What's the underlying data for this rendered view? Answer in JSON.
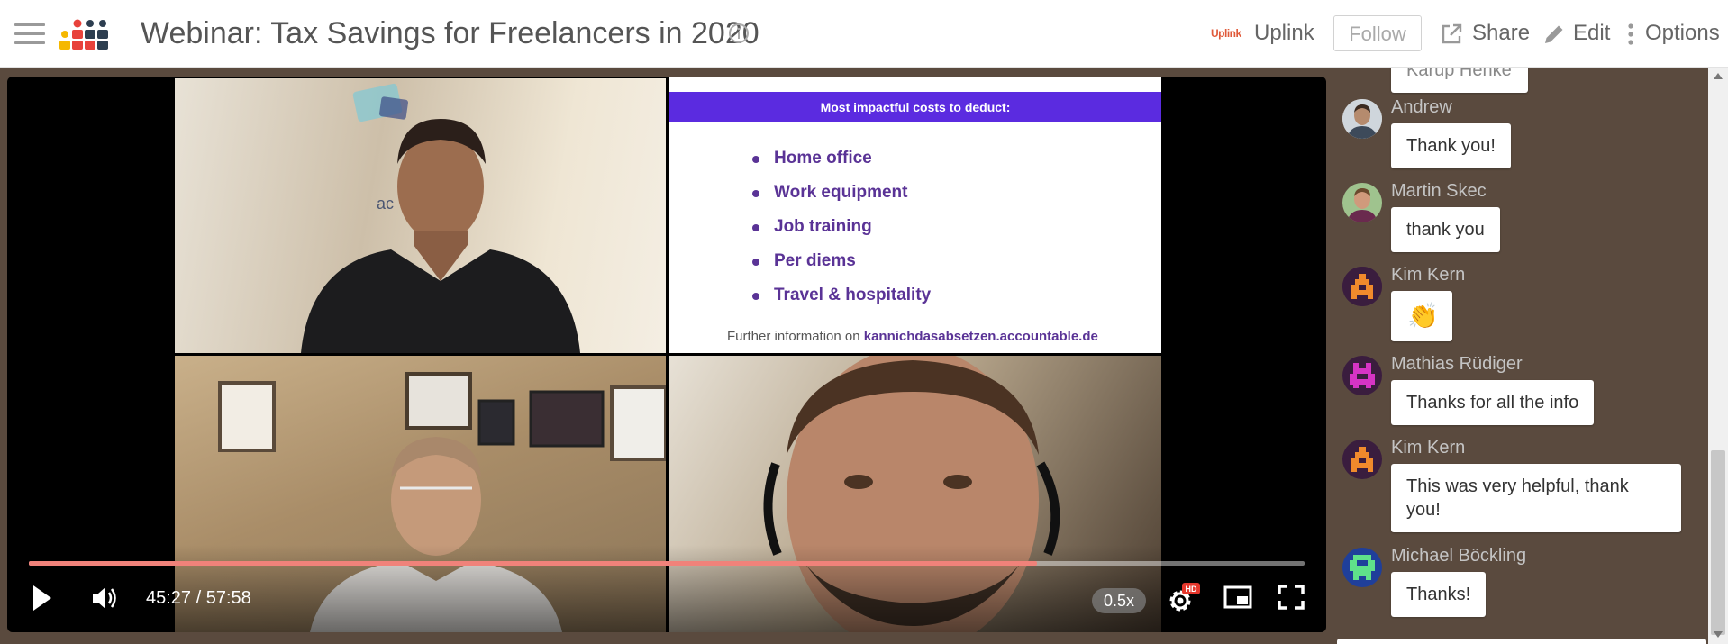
{
  "header": {
    "title": "Webinar: Tax Savings for Freelancers in 2020",
    "uplink_logo": "Uplink",
    "uplink_label": "Uplink",
    "follow_label": "Follow",
    "share_label": "Share",
    "edit_label": "Edit",
    "options_label": "Options"
  },
  "colors": {
    "accent": "#5b2be0",
    "progress": "#f0827a",
    "uplink_red": "#e05a3a"
  },
  "video": {
    "slide": {
      "heading": "Most impactful costs to deduct:",
      "items": [
        "Home office",
        "Work equipment",
        "Job training",
        "Per diems",
        "Travel & hospitality"
      ],
      "footer_prefix": "Further information on ",
      "footer_link": "kannichdasabsetzen.accountable.de"
    },
    "time_display": "45:27 / 57:58",
    "progress_fraction": 0.79,
    "speed": "0.5x",
    "quality_badge": "HD"
  },
  "chat": {
    "partial_bubble": "Karup Henke",
    "messages": [
      {
        "name": "Andrew",
        "text": "Thank you!",
        "avatar": "photo-avatar"
      },
      {
        "name": "Martin Skec",
        "text": "thank you",
        "avatar": "photo-avatar"
      },
      {
        "name": "Kim Kern",
        "text": "👏",
        "avatar": "pixel-avatar-orange"
      },
      {
        "name": "Mathias Rüdiger",
        "text": "Thanks for all the info",
        "avatar": "pixel-avatar-magenta"
      },
      {
        "name": "Kim Kern",
        "text": "This was very helpful, thank you!",
        "avatar": "pixel-avatar-orange"
      },
      {
        "name": "Michael Böckling",
        "text": "Thanks!",
        "avatar": "pixel-avatar-green"
      }
    ]
  }
}
